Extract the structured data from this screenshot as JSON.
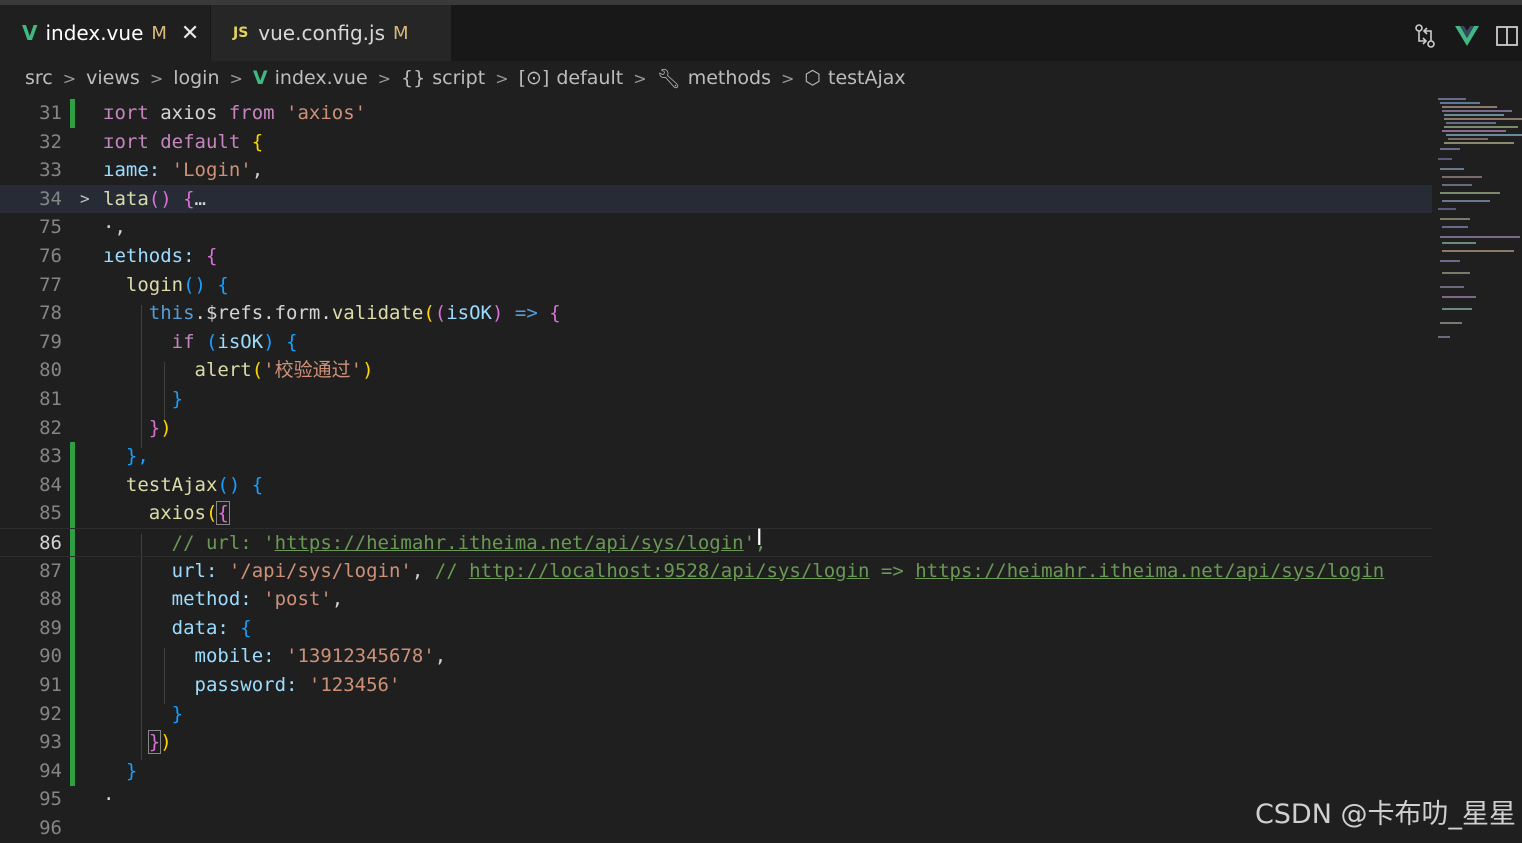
{
  "tabs": [
    {
      "icon": "vue-file-icon",
      "label": "index.vue",
      "status": "M",
      "close": "✕"
    },
    {
      "icon": "js-file-icon",
      "icon_text": "JS",
      "label": "vue.config.js",
      "status": "M"
    }
  ],
  "breadcrumb": {
    "items": [
      "src",
      "views",
      "login",
      "index.vue",
      "{}",
      "script",
      "default",
      "methods",
      "testAjax"
    ]
  },
  "editor": {
    "lines": [
      {
        "n": "31"
      },
      {
        "n": "32"
      },
      {
        "n": "33"
      },
      {
        "n": "34"
      },
      {
        "n": "75"
      },
      {
        "n": "76"
      },
      {
        "n": "77"
      },
      {
        "n": "78"
      },
      {
        "n": "79"
      },
      {
        "n": "80"
      },
      {
        "n": "81"
      },
      {
        "n": "82"
      },
      {
        "n": "83"
      },
      {
        "n": "84"
      },
      {
        "n": "85"
      },
      {
        "n": "86"
      },
      {
        "n": "87"
      },
      {
        "n": "88"
      },
      {
        "n": "89"
      },
      {
        "n": "90"
      },
      {
        "n": "91"
      },
      {
        "n": "92"
      },
      {
        "n": "93"
      },
      {
        "n": "94"
      },
      {
        "n": "95"
      },
      {
        "n": "96"
      }
    ],
    "code": {
      "l31": {
        "kw": "ɪort",
        "ident": " axios ",
        "from": "from",
        "str": " 'axios'"
      },
      "l32": {
        "kw": "ɪort",
        "def": " default ",
        "brace": "{"
      },
      "l33": {
        "prop": "ıame:",
        "str": " 'Login'",
        "punct": ","
      },
      "l34": {
        "fn": "lata",
        "parens": "()",
        "brace": " {",
        "ellipsis": "…"
      },
      "l75": {
        "text": "·,"
      },
      "l76": {
        "prop": "ıethods:",
        "brace": " {"
      },
      "l77": {
        "fn": "login",
        "parens": "()",
        "brace": " {"
      },
      "l78": {
        "this": "this",
        "chain": ".$refs.form.",
        "fn": "validate",
        "p1": "(",
        "p2": "(",
        "param": "isOK",
        "p3": ")",
        "arrow": " => ",
        "brace": "{"
      },
      "l79": {
        "kw": "if",
        "p1": " (",
        "param": "isOK",
        "p2": ")",
        "brace": " {"
      },
      "l80": {
        "fn": "alert",
        "p1": "(",
        "str": "'校验通过'",
        "p2": ")"
      },
      "l81": {
        "brace": "}"
      },
      "l82": {
        "b1": "}",
        "b2": ")"
      },
      "l83": {
        "brace": "},"
      },
      "l84": {
        "fn": "testAjax",
        "parens": "()",
        "brace": " {"
      },
      "l85": {
        "fn": "axios",
        "p1": "(",
        "brace": "{"
      },
      "l86": {
        "cm1": "// url: '",
        "link": "https://heimahr.itheima.net/api/sys/login",
        "cm2": "',"
      },
      "l87": {
        "prop": "url:",
        "str": " '/api/sys/login'",
        "punct": ",",
        "cm1": " // ",
        "link1": "http://localhost:9528/api/sys/login",
        "cm2": " => ",
        "link2": "https://heimahr.itheima.net/api/sys/login"
      },
      "l88": {
        "prop": "method:",
        "str": " 'post'",
        "punct": ","
      },
      "l89": {
        "prop": "data:",
        "brace": " {"
      },
      "l90": {
        "prop": "mobile:",
        "str": " '13912345678'",
        "punct": ","
      },
      "l91": {
        "prop": "password:",
        "str": " '123456'"
      },
      "l92": {
        "brace": "}"
      },
      "l93": {
        "b1": "}",
        "b2": ")"
      },
      "l94": {
        "brace": "}"
      },
      "l95": {
        "text": "·"
      },
      "l96": {
        "text": ""
      }
    }
  },
  "watermark": "CSDN @卡布叻_星星",
  "colors": {
    "vue_green": "#41b883",
    "modified": "#d7ba7d",
    "git_added": "#2ea043",
    "highlight": "#262b36"
  }
}
